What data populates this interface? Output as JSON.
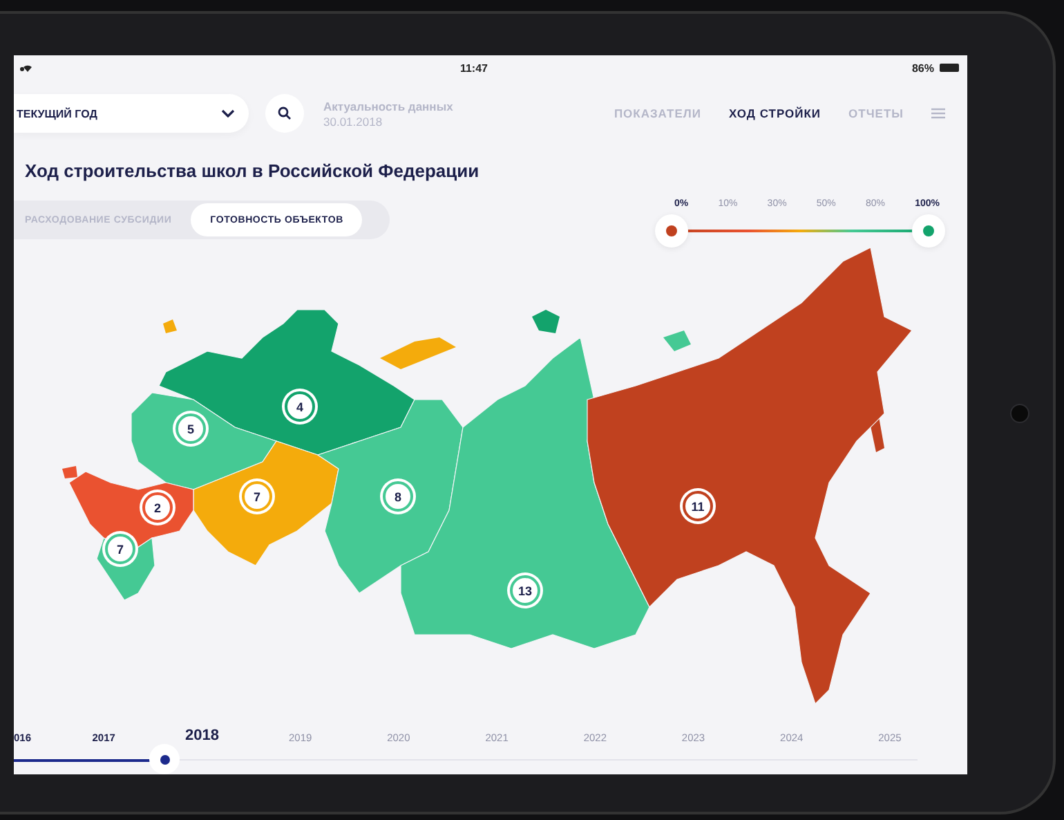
{
  "status_bar": {
    "time": "11:47",
    "battery": "86%"
  },
  "period_select": {
    "value": "ТЕКУЩИЙ ГОД"
  },
  "data_date": {
    "label": "Актуальность данных",
    "date": "30.01.2018"
  },
  "nav": [
    {
      "label": "ПОКАЗАТЕЛИ",
      "selected": false
    },
    {
      "label": "ХОД СТРОЙКИ",
      "selected": true
    },
    {
      "label": "ОТЧЕТЫ",
      "selected": false
    }
  ],
  "title": "Ход строительства школ в Российской Федерации",
  "tabs": [
    {
      "label": "РАСХОДОВАНИЕ СУБСИДИИ",
      "selected": false
    },
    {
      "label": "ГОТОВНОСТЬ ОБЪЕКТОВ",
      "selected": true
    }
  ],
  "legend": [
    {
      "label": "0%",
      "selected": true
    },
    {
      "label": "10%",
      "selected": false
    },
    {
      "label": "30%",
      "selected": false
    },
    {
      "label": "50%",
      "selected": false
    },
    {
      "label": "80%",
      "selected": false
    },
    {
      "label": "100%",
      "selected": true
    }
  ],
  "regions": [
    {
      "number": "4",
      "color": "#13a36c"
    },
    {
      "number": "5",
      "color": "#45c994"
    },
    {
      "number": "7",
      "color": "#f4ab0c"
    },
    {
      "number": "2",
      "color": "#ea5230"
    },
    {
      "number": "7",
      "color": "#45c994"
    },
    {
      "number": "8",
      "color": "#45c994"
    },
    {
      "number": "13",
      "color": "#45c994"
    },
    {
      "number": "11",
      "color": "#c0411f"
    }
  ],
  "timeline": [
    {
      "label": "016",
      "selected": false,
      "past": true
    },
    {
      "label": "2017",
      "selected": false,
      "past": true
    },
    {
      "label": "2018",
      "selected": true,
      "past": false
    },
    {
      "label": "2019",
      "selected": false,
      "past": false
    },
    {
      "label": "2020",
      "selected": false,
      "past": false
    },
    {
      "label": "2021",
      "selected": false,
      "past": false
    },
    {
      "label": "2022",
      "selected": false,
      "past": false
    },
    {
      "label": "2023",
      "selected": false,
      "past": false
    },
    {
      "label": "2024",
      "selected": false,
      "past": false
    },
    {
      "label": "2025",
      "selected": false,
      "past": false
    }
  ]
}
